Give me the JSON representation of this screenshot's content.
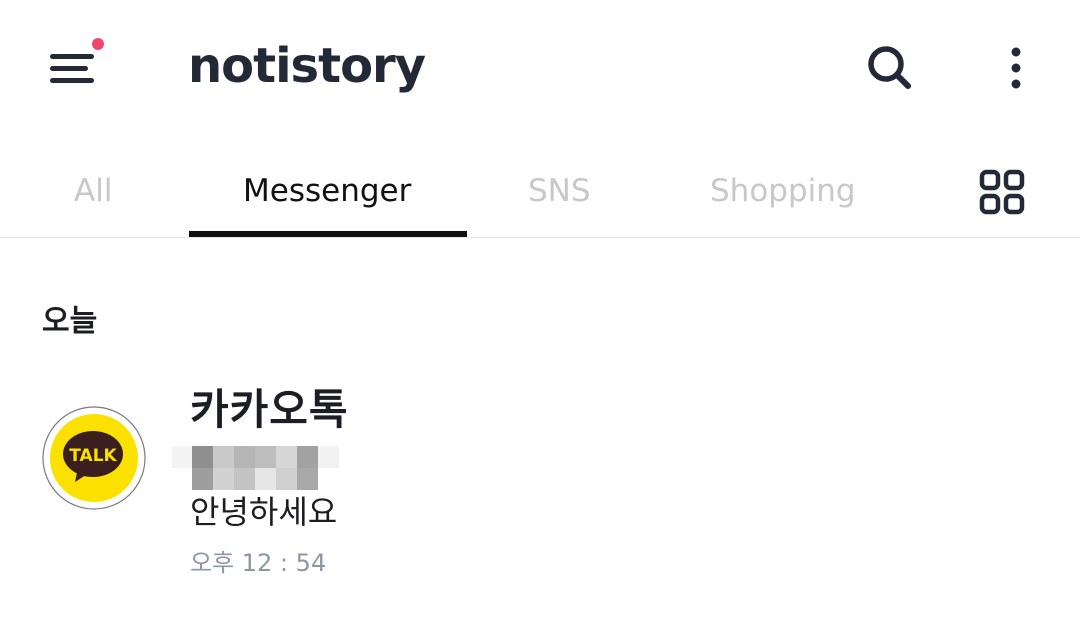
{
  "header": {
    "logo_text": "notistory",
    "menu_icon": "menu-icon",
    "search_icon": "search-icon",
    "more_icon": "more-vertical-icon",
    "notification_dot_color": "#f0466e",
    "text_color": "#232936"
  },
  "tabs": {
    "items": [
      {
        "label": "All",
        "active": false
      },
      {
        "label": "Messenger",
        "active": true
      },
      {
        "label": "SNS",
        "active": false
      },
      {
        "label": "Shopping",
        "active": false
      }
    ],
    "grid_icon": "grid-icon",
    "active_color": "#111111",
    "inactive_color": "#c6c8cc"
  },
  "section": {
    "title": "오늘"
  },
  "notifications": [
    {
      "app_name": "카카오톡",
      "app_icon": "kakaotalk-icon",
      "app_icon_text": "TALK",
      "app_icon_color": "#fae100",
      "sender": "",
      "message": "안녕하세요",
      "time": "오후 12 : 54"
    }
  ]
}
